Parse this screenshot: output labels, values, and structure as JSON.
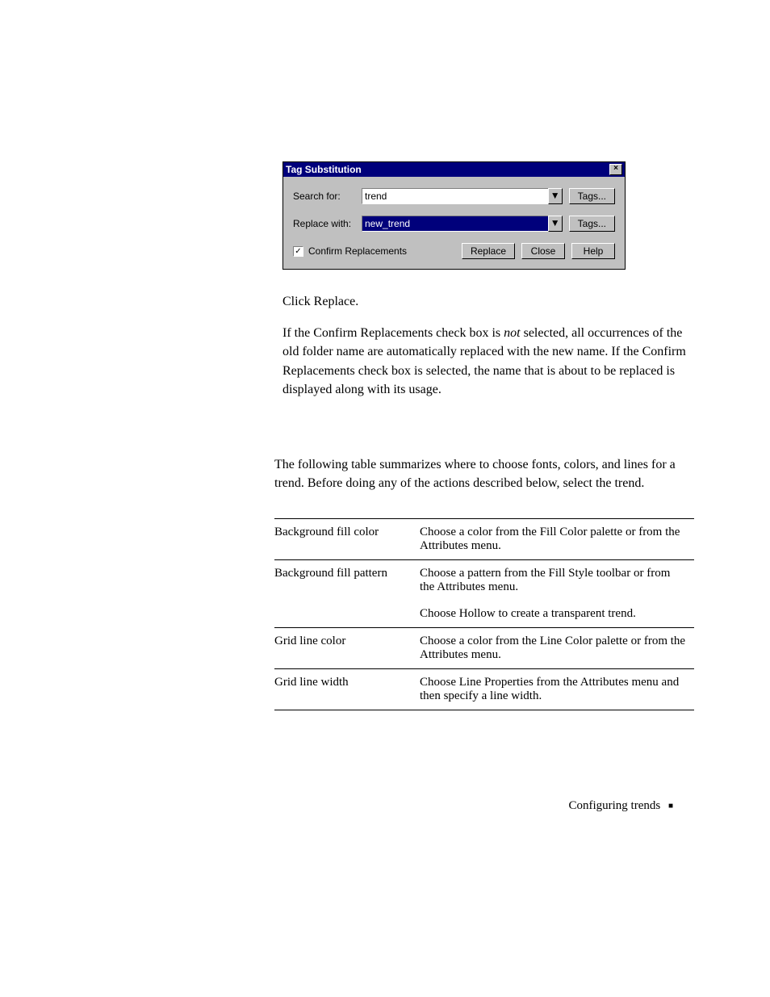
{
  "dialog": {
    "title": "Tag Substitution",
    "close_glyph": "×",
    "search_label": "Search for:",
    "search_value": "trend",
    "replace_label": "Replace with:",
    "replace_value": "new_trend",
    "dropdown_glyph": "▼",
    "tags_button": "Tags...",
    "confirm_label": "Confirm Replacements",
    "confirm_checked_glyph": "✓",
    "replace_button": "Replace",
    "close_button": "Close",
    "help_button": "Help"
  },
  "instr": {
    "click_replace": "Click Replace.",
    "confirm_text_pre": "If the Confirm Replacements check box is ",
    "confirm_text_em": "not",
    "confirm_text_post": " selected, all occurrences of the old folder name are automatically replaced with the new name. If the Confirm Replacements check box is selected, the name that is about to be replaced is displayed along with its usage."
  },
  "intro": "The following table summarizes where to choose fonts, colors, and lines for a trend. Before doing any of the actions described below, select the trend.",
  "table": {
    "rows": [
      {
        "item": "Background fill color",
        "desc": "Choose a color from the Fill Color palette or from the Attributes menu."
      },
      {
        "item": "Background fill pattern",
        "desc": "Choose a pattern from the Fill Style toolbar or from the Attributes menu."
      },
      {
        "item": "",
        "desc": "Choose Hollow to create a transparent trend."
      },
      {
        "item": "Grid line color",
        "desc": "Choose a color from the Line Color palette or from the Attributes menu."
      },
      {
        "item": "Grid line width",
        "desc": "Choose Line Properties from the Attributes menu and then specify a line width."
      }
    ]
  },
  "footer": {
    "text": "Configuring trends",
    "bullet": "■"
  }
}
